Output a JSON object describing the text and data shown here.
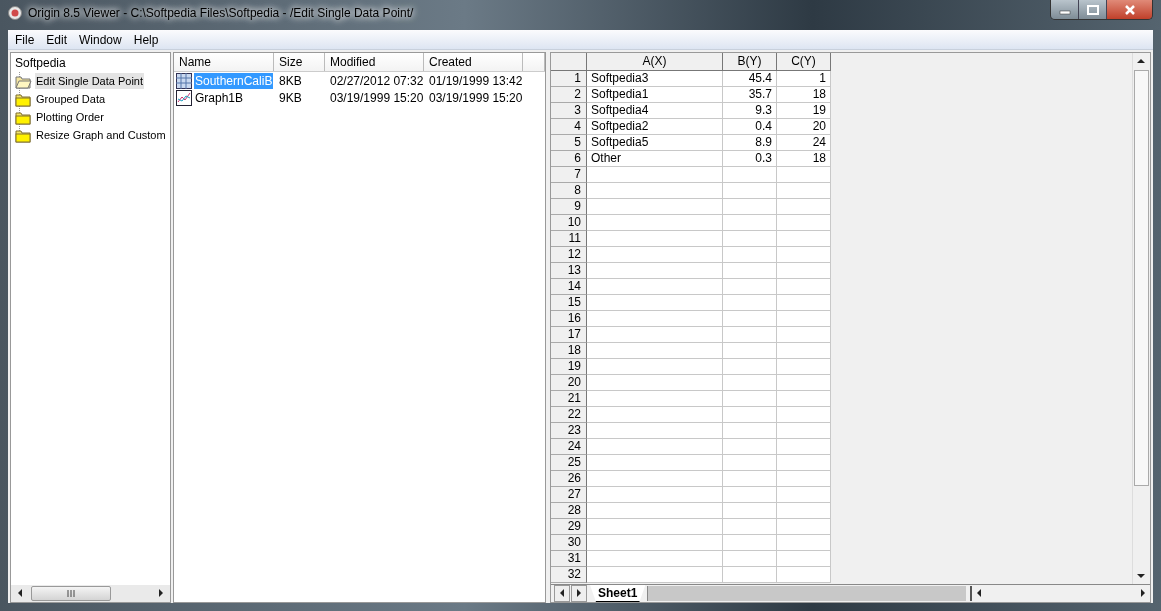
{
  "window": {
    "title": "Origin 8.5 Viewer - C:\\Softpedia Files\\Softpedia - /Edit Single Data Point/"
  },
  "menu": [
    "File",
    "Edit",
    "Window",
    "Help"
  ],
  "tree": {
    "root": "Softpedia",
    "items": [
      {
        "label": "Edit Single Data Point",
        "selected": true
      },
      {
        "label": "Grouped Data",
        "selected": false
      },
      {
        "label": "Plotting Order",
        "selected": false
      },
      {
        "label": "Resize Graph and Custom",
        "selected": false
      }
    ]
  },
  "file_list": {
    "columns": [
      "Name",
      "Size",
      "Modified",
      "Created"
    ],
    "rows": [
      {
        "kind": "worksheet",
        "name": "SouthernCaliB",
        "size": "8KB",
        "modified": "02/27/2012 07:32",
        "created": "01/19/1999 13:42",
        "selected": true
      },
      {
        "kind": "graph",
        "name": "Graph1B",
        "size": "9KB",
        "modified": "03/19/1999 15:20",
        "created": "03/19/1999 15:20",
        "selected": false
      }
    ]
  },
  "worksheet": {
    "columns": [
      "A(X)",
      "B(Y)",
      "C(Y)"
    ],
    "rows": [
      {
        "number": "1",
        "cells": [
          "Softpedia3",
          "45.4",
          "1"
        ]
      },
      {
        "number": "2",
        "cells": [
          "Softpedia1",
          "35.7",
          "18"
        ]
      },
      {
        "number": "3",
        "cells": [
          "Softpedia4",
          "9.3",
          "19"
        ]
      },
      {
        "number": "4",
        "cells": [
          "Softpedia2",
          "0.4",
          "20"
        ]
      },
      {
        "number": "5",
        "cells": [
          "Softpedia5",
          "8.9",
          "24"
        ]
      },
      {
        "number": "6",
        "cells": [
          "Other",
          "0.3",
          "18"
        ]
      },
      {
        "number": "7"
      },
      {
        "number": "8"
      },
      {
        "number": "9"
      },
      {
        "number": "10"
      },
      {
        "number": "11"
      },
      {
        "number": "12"
      },
      {
        "number": "13"
      },
      {
        "number": "14"
      },
      {
        "number": "15"
      },
      {
        "number": "16"
      },
      {
        "number": "17"
      },
      {
        "number": "18"
      },
      {
        "number": "19"
      },
      {
        "number": "20"
      },
      {
        "number": "21"
      },
      {
        "number": "22"
      },
      {
        "number": "23"
      },
      {
        "number": "24"
      },
      {
        "number": "25"
      },
      {
        "number": "26"
      },
      {
        "number": "27"
      },
      {
        "number": "28"
      },
      {
        "number": "29"
      },
      {
        "number": "30"
      },
      {
        "number": "31"
      },
      {
        "number": "32"
      }
    ],
    "sheet_tabs": [
      {
        "label": "Sheet1",
        "selected": true
      }
    ]
  }
}
